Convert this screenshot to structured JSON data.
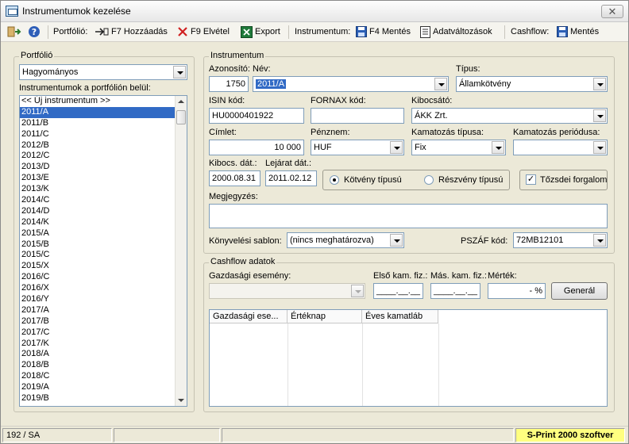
{
  "window": {
    "title": "Instrumentumok kezelése",
    "close_label": "✕"
  },
  "toolbar": {
    "portfolio_label": "Portfólió:",
    "add_label": "F7 Hozzáadás",
    "remove_label": "F9 Elvétel",
    "export_label": "Export",
    "instrument_label": "Instrumentum:",
    "save_label": "F4 Mentés",
    "changes_label": "Adatváltozások",
    "cashflow_label": "Cashflow:",
    "cashflow_save_label": "Mentés"
  },
  "portfolio": {
    "group_label": "Portfólió",
    "selected": "Hagyományos",
    "list_label": "Instrumentumok a portfólión belül:",
    "items": [
      "<< Új instrumentum >>",
      "2011/A",
      "2011/B",
      "2011/C",
      "2012/B",
      "2012/C",
      "2013/D",
      "2013/E",
      "2013/K",
      "2014/C",
      "2014/D",
      "2014/K",
      "2015/A",
      "2015/B",
      "2015/C",
      "2015/X",
      "2016/C",
      "2016/X",
      "2016/Y",
      "2017/A",
      "2017/B",
      "2017/C",
      "2017/K",
      "2018/A",
      "2018/B",
      "2018/C",
      "2019/A",
      "2019/B"
    ],
    "selected_index": 1
  },
  "instrument": {
    "group_label": "Instrumentum",
    "id_label": "Azonosító:",
    "id_value": "1750",
    "name_label": "Név:",
    "name_value": "2011/A",
    "type_label": "Típus:",
    "type_value": "Államkötvény",
    "isin_label": "ISIN kód:",
    "isin_value": "HU0000401922",
    "fornax_label": "FORNAX kód:",
    "fornax_value": "",
    "issuer_label": "Kibocsátó:",
    "issuer_value": "ÁKK Zrt.",
    "nominal_label": "Címlet:",
    "nominal_value": "10 000",
    "currency_label": "Pénznem:",
    "currency_value": "HUF",
    "interest_type_label": "Kamatozás típusa:",
    "interest_type_value": "Fix",
    "interest_period_label": "Kamatozás periódusa:",
    "interest_period_value": "",
    "issue_date_label": "Kibocs. dát.:",
    "issue_date_value": "2000.08.31",
    "maturity_label": "Lejárat dát.:",
    "maturity_value": "2011.02.12",
    "radio_bond_label": "Kötvény típusú",
    "radio_share_label": "Részvény típusú",
    "exchange_label": "Tőzsdei forgalom",
    "comment_label": "Megjegyzés:",
    "comment_value": "",
    "template_label": "Könyvelési sablon:",
    "template_value": "(nincs meghatározva)",
    "pszaf_label": "PSZÁF kód:",
    "pszaf_value": "72MB12101"
  },
  "cashflow": {
    "group_label": "Cashflow adatok",
    "event_label": "Gazdasági esemény:",
    "event_value": "",
    "first_label": "Első kam. fiz.:",
    "first_value": "____.__.__",
    "next_label": "Más. kam. fiz.:",
    "next_value": "____.__.__",
    "rate_label": "Mérték:",
    "rate_value": "- %",
    "generate_label": "Generál",
    "columns": [
      "Gazdasági ese...",
      "Értéknap",
      "Éves kamatláb"
    ]
  },
  "statusbar": {
    "left": "192 / SA",
    "right": "S-Print 2000 szoftver"
  },
  "colors": {
    "selection": "#316ac5",
    "status_highlight": "#ffff80"
  },
  "icons": [
    "app-icon",
    "exit-icon",
    "help-icon",
    "add-icon",
    "remove-icon",
    "excel-icon",
    "floppy-icon",
    "document-icon"
  ]
}
